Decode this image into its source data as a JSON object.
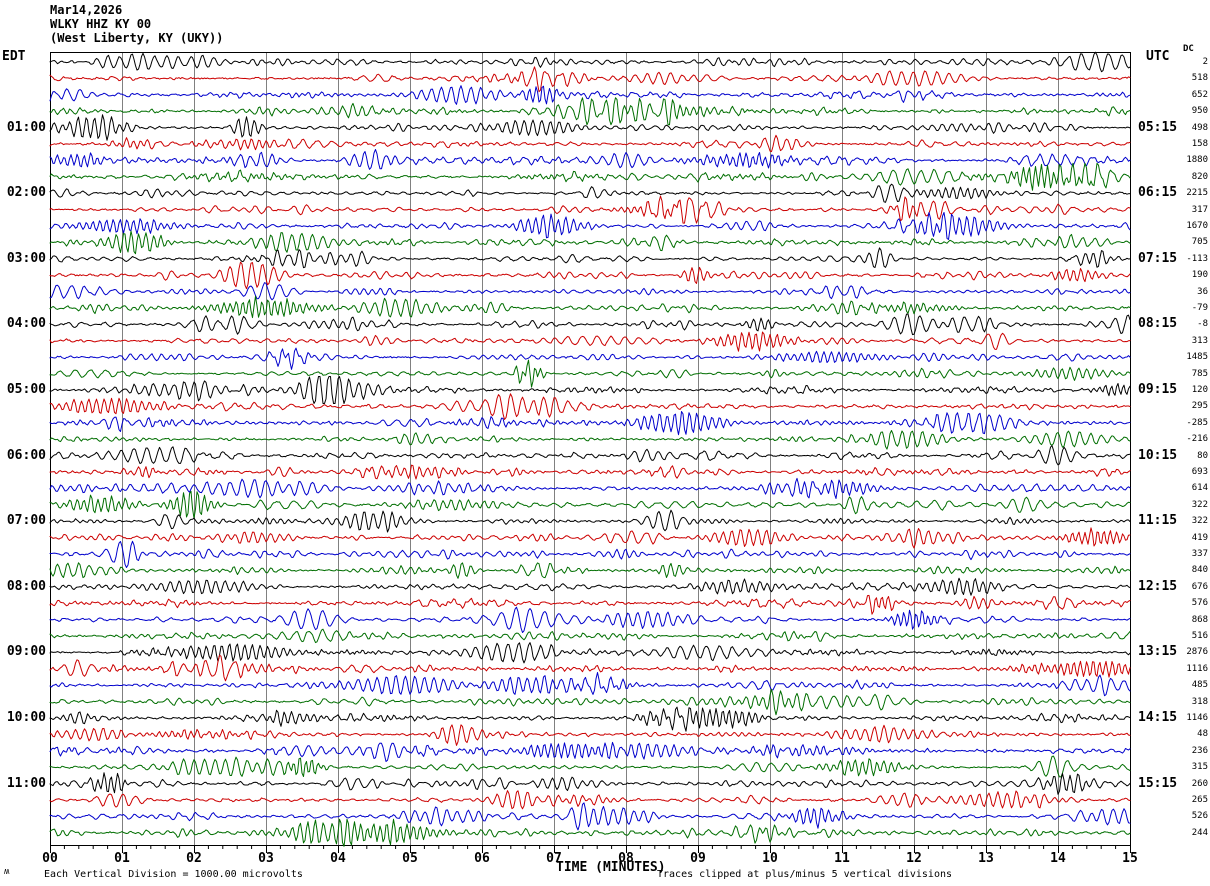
{
  "header": {
    "date": "Mar14,2026",
    "station": "WLKY HHZ KY 00",
    "location": "(West Liberty, KY (UKY))"
  },
  "left_axis": {
    "label": "EDT",
    "hour_labels": [
      "01:00",
      "02:00",
      "03:00",
      "04:00",
      "05:00",
      "06:00",
      "07:00",
      "08:00",
      "09:00",
      "10:00",
      "11:00"
    ]
  },
  "right_axis": {
    "label": "UTC",
    "dc_label": "DC",
    "hour_labels": [
      "05:15",
      "06:15",
      "07:15",
      "08:15",
      "09:15",
      "10:15",
      "11:15",
      "12:15",
      "13:15",
      "14:15",
      "15:15"
    ]
  },
  "x_axis": {
    "title": "TIME (MINUTES)",
    "tick_labels": [
      "00",
      "01",
      "02",
      "03",
      "04",
      "05",
      "06",
      "07",
      "08",
      "09",
      "10",
      "11",
      "12",
      "13",
      "14",
      "15"
    ]
  },
  "footer": {
    "scale_note": "Each Vertical Division = 1000.00 microvolts",
    "clip_note": "Traces clipped at plus/minus 5 vertical divisions",
    "corner_glyph": "ʍ"
  },
  "colors": {
    "background": "#ffffff",
    "grid": "#808080",
    "border": "#000000",
    "text": "#000000"
  },
  "chart_data": {
    "type": "line",
    "subtype": "seismogram-helicorder",
    "title": "WLKY HHZ KY 00 (West Liberty, KY (UKY)) — Mar14,2026",
    "xlabel": "TIME (MINUTES)",
    "x_range_minutes": [
      0,
      15
    ],
    "minutes_per_line": 15,
    "lines": 48,
    "grid": true,
    "color_map": {
      "black": "#000000",
      "red": "#cc0000",
      "blue": "#0000cc",
      "green": "#006e00"
    },
    "trace_color_cycle": [
      "black",
      "red",
      "blue",
      "green"
    ],
    "waveform": {
      "synthesized": true,
      "seed": 7,
      "clip_divisions": 5
    },
    "rows": [
      {
        "edt": "00:00",
        "color": "black",
        "dc": "2"
      },
      {
        "edt": "00:15",
        "color": "red",
        "dc": "518"
      },
      {
        "edt": "00:30",
        "color": "blue",
        "dc": "652"
      },
      {
        "edt": "00:45",
        "color": "green",
        "dc": "950"
      },
      {
        "edt": "01:00",
        "color": "black",
        "dc": "498"
      },
      {
        "edt": "01:15",
        "color": "red",
        "dc": "158"
      },
      {
        "edt": "01:30",
        "color": "blue",
        "dc": "1880"
      },
      {
        "edt": "01:45",
        "color": "green",
        "dc": "820"
      },
      {
        "edt": "02:00",
        "color": "black",
        "dc": "2215"
      },
      {
        "edt": "02:15",
        "color": "red",
        "dc": "317"
      },
      {
        "edt": "02:30",
        "color": "blue",
        "dc": "1670"
      },
      {
        "edt": "02:45",
        "color": "green",
        "dc": "705"
      },
      {
        "edt": "03:00",
        "color": "black",
        "dc": "-113"
      },
      {
        "edt": "03:15",
        "color": "red",
        "dc": "190"
      },
      {
        "edt": "03:30",
        "color": "blue",
        "dc": "36"
      },
      {
        "edt": "03:45",
        "color": "green",
        "dc": "-79"
      },
      {
        "edt": "04:00",
        "color": "black",
        "dc": "-8"
      },
      {
        "edt": "04:15",
        "color": "red",
        "dc": "313"
      },
      {
        "edt": "04:30",
        "color": "blue",
        "dc": "1485"
      },
      {
        "edt": "04:45",
        "color": "green",
        "dc": "785"
      },
      {
        "edt": "05:00",
        "color": "black",
        "dc": "120"
      },
      {
        "edt": "05:15",
        "color": "red",
        "dc": "295"
      },
      {
        "edt": "05:30",
        "color": "blue",
        "dc": "-285"
      },
      {
        "edt": "05:45",
        "color": "green",
        "dc": "-216"
      },
      {
        "edt": "06:00",
        "color": "black",
        "dc": "80"
      },
      {
        "edt": "06:15",
        "color": "red",
        "dc": "693"
      },
      {
        "edt": "06:30",
        "color": "blue",
        "dc": "614"
      },
      {
        "edt": "06:45",
        "color": "green",
        "dc": "322"
      },
      {
        "edt": "07:00",
        "color": "black",
        "dc": "322"
      },
      {
        "edt": "07:15",
        "color": "red",
        "dc": "419"
      },
      {
        "edt": "07:30",
        "color": "blue",
        "dc": "337"
      },
      {
        "edt": "07:45",
        "color": "green",
        "dc": "840"
      },
      {
        "edt": "08:00",
        "color": "black",
        "dc": "676"
      },
      {
        "edt": "08:15",
        "color": "red",
        "dc": "576"
      },
      {
        "edt": "08:30",
        "color": "blue",
        "dc": "868"
      },
      {
        "edt": "08:45",
        "color": "green",
        "dc": "516"
      },
      {
        "edt": "09:00",
        "color": "black",
        "dc": "2876"
      },
      {
        "edt": "09:15",
        "color": "red",
        "dc": "1116"
      },
      {
        "edt": "09:30",
        "color": "blue",
        "dc": "485"
      },
      {
        "edt": "09:45",
        "color": "green",
        "dc": "318"
      },
      {
        "edt": "10:00",
        "color": "black",
        "dc": "1146"
      },
      {
        "edt": "10:15",
        "color": "red",
        "dc": "48"
      },
      {
        "edt": "10:30",
        "color": "blue",
        "dc": "236"
      },
      {
        "edt": "10:45",
        "color": "green",
        "dc": "315"
      },
      {
        "edt": "11:00",
        "color": "black",
        "dc": "260"
      },
      {
        "edt": "11:15",
        "color": "red",
        "dc": "265"
      },
      {
        "edt": "11:30",
        "color": "blue",
        "dc": "526"
      },
      {
        "edt": "11:45",
        "color": "green",
        "dc": "244"
      }
    ]
  }
}
